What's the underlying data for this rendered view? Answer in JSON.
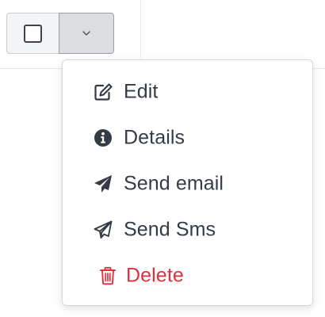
{
  "toolbar": {
    "select_all_checkbox": {
      "checked": false
    },
    "menu_toggle_icon": "chevron-down-icon"
  },
  "menu": {
    "items": [
      {
        "label": "Edit",
        "icon": "edit-icon",
        "color": "#353b44"
      },
      {
        "label": "Details",
        "icon": "info-icon",
        "color": "#353b44"
      },
      {
        "label": "Send email",
        "icon": "send-email-icon",
        "color": "#353b44"
      },
      {
        "label": "Send Sms",
        "icon": "send-sms-icon",
        "color": "#353b44"
      },
      {
        "label": "Delete",
        "icon": "trash-icon",
        "color": "#e0303d"
      }
    ]
  },
  "colors": {
    "text": "#353b44",
    "danger": "#e0303d",
    "toggle_bg": "#dcdde0",
    "border": "#c9ccd1"
  }
}
